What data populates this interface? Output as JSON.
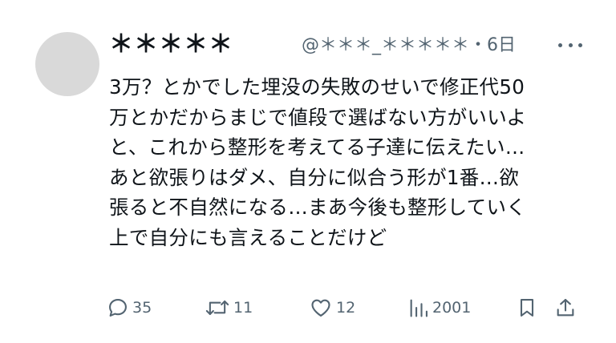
{
  "post": {
    "display_name": "＊＊＊＊＊",
    "handle": "@＊＊＊_＊＊＊＊＊",
    "separator": "・",
    "time": "6日",
    "body": "3万？とかでした埋没の失敗のせいで修正代50\n万とかだからまじで値段で選ばない方がいいよ\nと、これから整形を考えてる子達に伝えたい…\nあと欲張りはダメ、自分に似合う形が1番…欲\n張ると不自然になる…まあ今後も整形していく\n上で自分にも言えることだけど"
  },
  "actions": {
    "replies": "35",
    "reposts": "11",
    "likes": "12",
    "views": "2001"
  },
  "icons": [
    "more-icon",
    "reply-icon",
    "repost-icon",
    "like-icon",
    "views-icon",
    "bookmark-icon",
    "share-icon"
  ],
  "colors": {
    "text": "#0f1419",
    "secondary": "#536471",
    "avatar": "#d9d9d9"
  }
}
